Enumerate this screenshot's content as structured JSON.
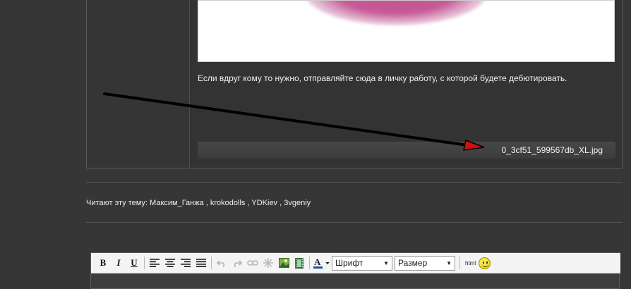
{
  "post": {
    "text": "Если вдруг кому то нужно, отправляйте сюда в личку работу, с которой будете дебютировать.",
    "attachment_name": "0_3cf51_599567db_XL.jpg"
  },
  "readers": {
    "label": "Читают эту тему:",
    "names": "Максим_Ганжа , krokodolls , YDKiev , 3vgeniy"
  },
  "editor": {
    "font_select": "Шрифт",
    "size_select": "Размер",
    "html_label": "html",
    "bold_label": "B",
    "italic_label": "I",
    "underline_label": "U"
  },
  "colors": {
    "background": "#363636",
    "arrow_head": "#d01010"
  }
}
